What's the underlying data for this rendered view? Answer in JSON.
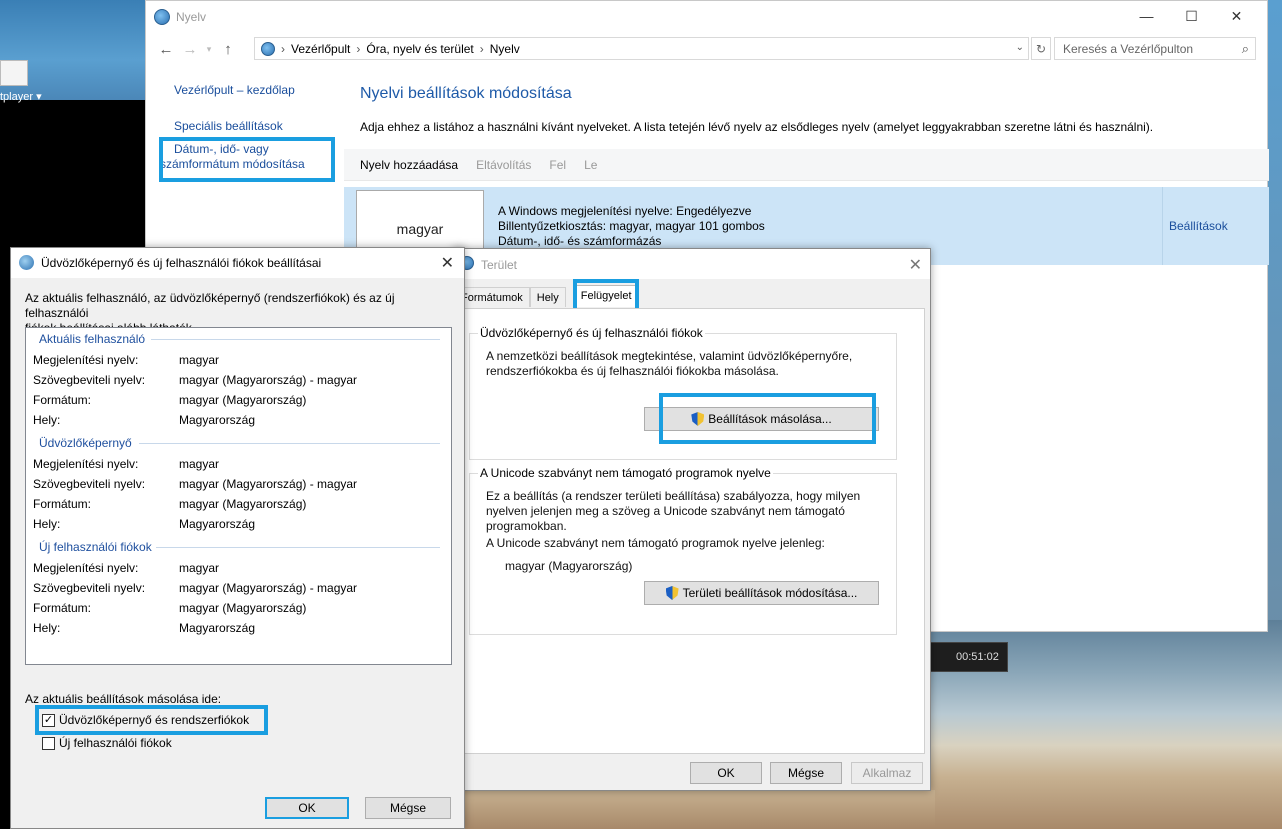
{
  "desktop": {
    "taskbar_label": "tplayer ▾",
    "media_time": "00:51:02"
  },
  "control_panel": {
    "window_title": "Nyelv",
    "address": [
      "Vezérlőpult",
      "Óra, nyelv és terület",
      "Nyelv"
    ],
    "search_placeholder": "Keresés a Vezérlőpulton",
    "left_nav": {
      "home": "Vezérlőpult – kezdőlap",
      "advanced": "Speciális beállítások",
      "date_format_line1": "Dátum-, idő- vagy",
      "date_format_line2": "számformátum módosítása"
    },
    "title": "Nyelvi beállítások módosítása",
    "description": "Adja ehhez a listához a használni kívánt nyelveket. A lista tetején lévő nyelv az elsődleges nyelv (amelyet leggyakrabban szeretne látni és használni).",
    "toolbar": {
      "add": "Nyelv hozzáadása",
      "remove": "Eltávolítás",
      "up": "Fel",
      "down": "Le"
    },
    "language": {
      "name": "magyar",
      "info1": "A Windows megjelenítési nyelve: Engedélyezve",
      "info2": "Billentyűzetkiosztás: magyar, magyar 101 gombos",
      "info3": "Dátum-, idő- és számformázás",
      "settings_link": "Beállítások"
    }
  },
  "region_dialog": {
    "title": "Terület",
    "tabs": [
      "Formátumok",
      "Hely",
      "Felügyelet"
    ],
    "group1": {
      "title": "Üdvözlőképernyő és új felhasználói fiókok",
      "line1": "A nemzetközi beállítások megtekintése, valamint üdvözlőképernyőre,",
      "line2": "rendszerfiókokba és új felhasználói fiókokba másolása.",
      "button": "Beállítások másolása..."
    },
    "group2": {
      "title": "A Unicode szabványt nem támogató programok nyelve",
      "line1": "Ez a beállítás (a rendszer területi beállítása) szabályozza, hogy milyen",
      "line2": "nyelven jelenjen meg a szöveg a Unicode szabványt nem támogató",
      "line3": "programokban.",
      "current_label": "A Unicode szabványt nem támogató programok nyelve jelenleg:",
      "current_value": "magyar (Magyarország)",
      "button": "Területi beállítások módosítása..."
    },
    "buttons": {
      "ok": "OK",
      "cancel": "Mégse",
      "apply": "Alkalmaz"
    }
  },
  "welcome_dialog": {
    "title": "Üdvözlőképernyő és új felhasználói fiókok beállításai",
    "desc_line1": "Az aktuális felhasználó, az üdvözlőképernyő (rendszerfiókok) és az új felhasználói",
    "desc_line2": "fiókok beállításai alább láthatók.",
    "labels": {
      "display": "Megjelenítési nyelv:",
      "input": "Szövegbeviteli nyelv:",
      "format": "Formátum:",
      "location": "Hely:"
    },
    "sections": [
      {
        "title": "Aktuális felhasználó",
        "display": "magyar",
        "input": "magyar (Magyarország) - magyar",
        "format": "magyar (Magyarország)",
        "location": "Magyarország"
      },
      {
        "title": "Üdvözlőképernyő",
        "display": "magyar",
        "input": "magyar (Magyarország) - magyar",
        "format": "magyar (Magyarország)",
        "location": "Magyarország"
      },
      {
        "title": "Új felhasználói fiókok",
        "display": "magyar",
        "input": "magyar (Magyarország) - magyar",
        "format": "magyar (Magyarország)",
        "location": "Magyarország"
      }
    ],
    "copy_label": "Az aktuális beállítások másolása ide:",
    "checkbox1": {
      "label": "Üdvözlőképernyő és rendszerfiókok",
      "checked": true
    },
    "checkbox2": {
      "label": "Új felhasználói fiókok",
      "checked": false
    },
    "ok": "OK",
    "cancel": "Mégse"
  },
  "colors": {
    "highlight": "#1a9ee0",
    "link": "#1a4e9c",
    "title": "#1e5aa8",
    "selected_row": "#cce4f7"
  }
}
